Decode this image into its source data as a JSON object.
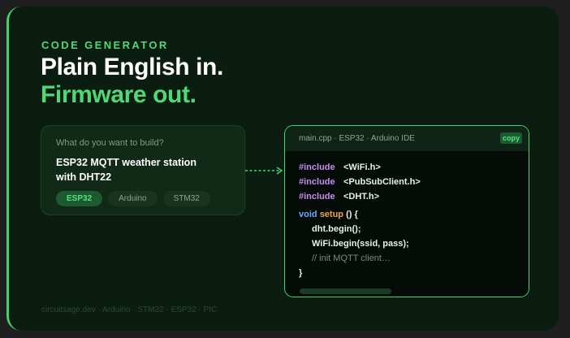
{
  "hero": {
    "eyebrow": "CODE GENERATOR",
    "headline_line1": "Plain English in.",
    "headline_line2": "Firmware out."
  },
  "prompt": {
    "label": "What do you want to build?",
    "value": "ESP32 MQTT weather station with DHT22",
    "chips": [
      {
        "label": "ESP32",
        "active": true
      },
      {
        "label": "Arduino",
        "active": false
      },
      {
        "label": "STM32",
        "active": false
      }
    ]
  },
  "code_panel": {
    "title": "main.cpp · ESP32 · Arduino IDE",
    "copy_label": "copy",
    "includes": [
      {
        "directive": "#include",
        "file": "<WiFi.h>"
      },
      {
        "directive": "#include",
        "file": "<PubSubClient.h>"
      },
      {
        "directive": "#include",
        "file": "<DHT.h>"
      }
    ],
    "func_return": "void",
    "func_name": "setup",
    "func_sig": " () {",
    "body": [
      "dht.begin();",
      "WiFi.begin(ssid, pass);"
    ],
    "comment": "// init MQTT client…",
    "closing": "}"
  },
  "footer": {
    "text": "circuitsage.dev · Arduino · STM32 · ESP32 · PIC"
  },
  "colors": {
    "accent": "#3ed66b",
    "card_bg": "#0b1d11",
    "include_kw": "#c78af0",
    "void_kw": "#6aa8ff",
    "func_name": "#f0a33d"
  }
}
